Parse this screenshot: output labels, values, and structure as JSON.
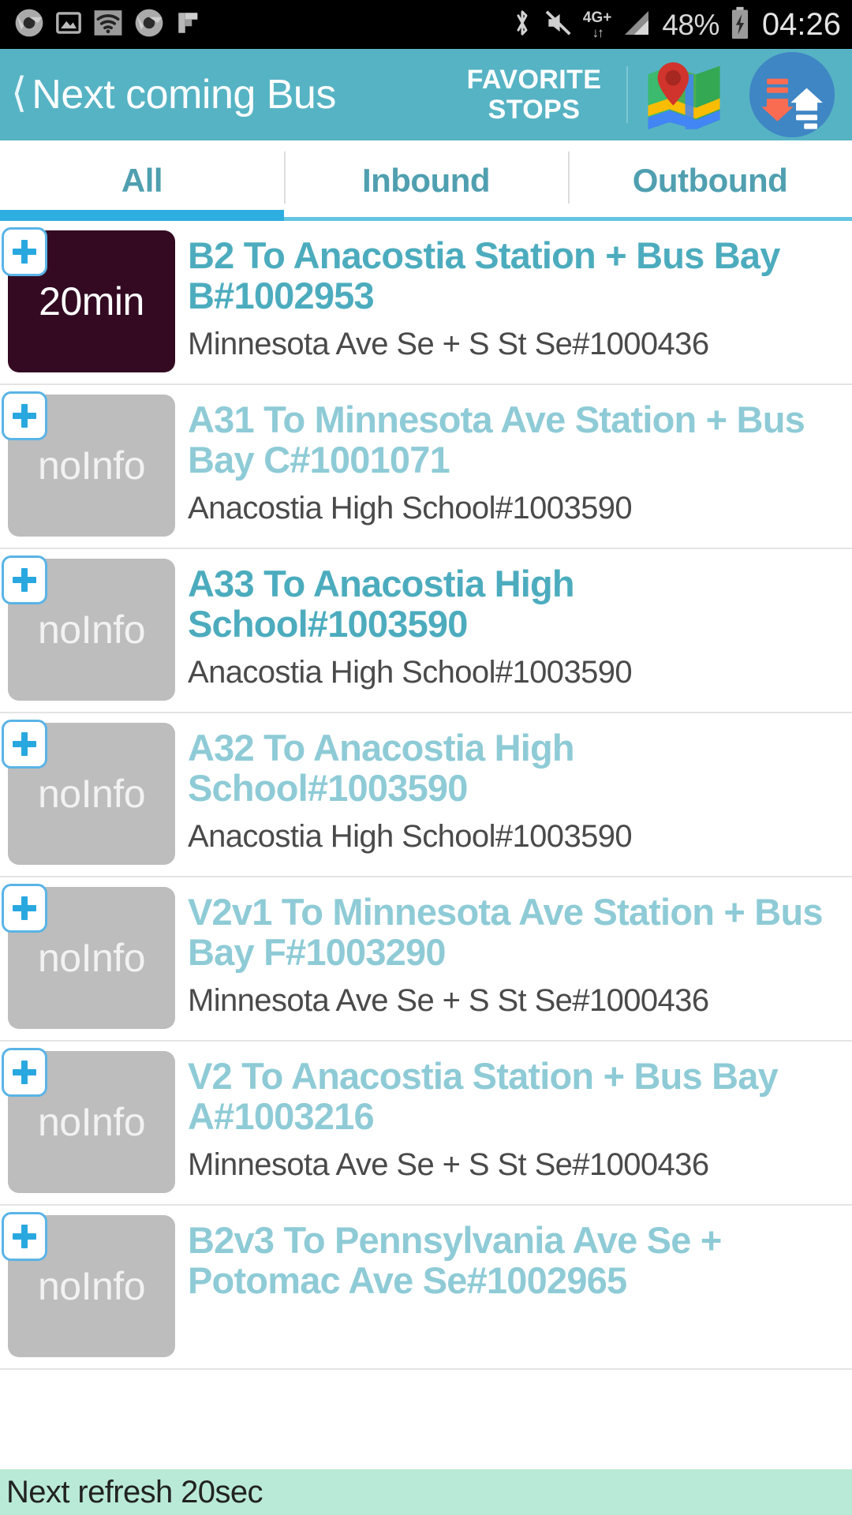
{
  "status_bar": {
    "left_icons": [
      "chrome-icon",
      "photo-icon",
      "wifi-icon",
      "chrome-icon",
      "flipboard-icon"
    ],
    "right_icons": [
      "bluetooth-icon",
      "mute-icon",
      "signal-icon",
      "battery-icon"
    ],
    "network_label": "4G+",
    "network_arrows": "↓↑",
    "battery_percent": "48%",
    "clock": "04:26"
  },
  "appbar": {
    "back_icon": "back-chevron-icon",
    "title": "Next coming Bus",
    "favorite_stops_line1": "FAVORITE",
    "favorite_stops_line2": "STOPS",
    "map_icon": "map-icon",
    "refresh_icon": "refresh-updown-icon",
    "background_color": "#56b3c4"
  },
  "tabs": {
    "active_index": 0,
    "items": [
      {
        "label": "All"
      },
      {
        "label": "Inbound"
      },
      {
        "label": "Outbound"
      }
    ],
    "active_indicator_color": "#2eaee0",
    "inactive_indicator_color": "#63c5e2",
    "label_color": "#4f9fb0"
  },
  "list": {
    "rows": [
      {
        "badge": "20min",
        "badge_type": "timed",
        "badge_color": "#330a22",
        "title": "B2 To Anacostia Station + Bus Bay B#1002953",
        "subtitle": "Minnesota Ave Se + S St Se#1000436",
        "title_style": "strong",
        "add_icon": "plus-icon"
      },
      {
        "badge": "noInfo",
        "badge_type": "noinfo",
        "badge_color": "#bdbdbd",
        "title": "A31 To Minnesota Ave Station + Bus Bay C#1001071",
        "subtitle": "Anacostia High School#1003590",
        "title_style": "faded",
        "add_icon": "plus-icon"
      },
      {
        "badge": "noInfo",
        "badge_type": "noinfo",
        "badge_color": "#bdbdbd",
        "title": "A33 To Anacostia High School#1003590",
        "subtitle": "Anacostia High School#1003590",
        "title_style": "strong",
        "add_icon": "plus-icon"
      },
      {
        "badge": "noInfo",
        "badge_type": "noinfo",
        "badge_color": "#bdbdbd",
        "title": "A32 To Anacostia High School#1003590",
        "subtitle": "Anacostia High School#1003590",
        "title_style": "faded",
        "add_icon": "plus-icon"
      },
      {
        "badge": "noInfo",
        "badge_type": "noinfo",
        "badge_color": "#bdbdbd",
        "title": "V2v1 To Minnesota Ave Station + Bus Bay F#1003290",
        "subtitle": "Minnesota Ave Se + S St Se#1000436",
        "title_style": "faded",
        "add_icon": "plus-icon"
      },
      {
        "badge": "noInfo",
        "badge_type": "noinfo",
        "badge_color": "#bdbdbd",
        "title": "V2 To Anacostia Station + Bus Bay A#1003216",
        "subtitle": "Minnesota Ave Se + S St Se#1000436",
        "title_style": "faded",
        "add_icon": "plus-icon"
      },
      {
        "badge": "noInfo",
        "badge_type": "noinfo",
        "badge_color": "#bdbdbd",
        "title": "B2v3 To Pennsylvania Ave Se + Potomac Ave Se#1002965",
        "subtitle": "",
        "title_style": "faded",
        "add_icon": "plus-icon"
      }
    ]
  },
  "bottom_bar": {
    "text": "Next refresh 20sec",
    "background_color": "#b9ead8"
  }
}
